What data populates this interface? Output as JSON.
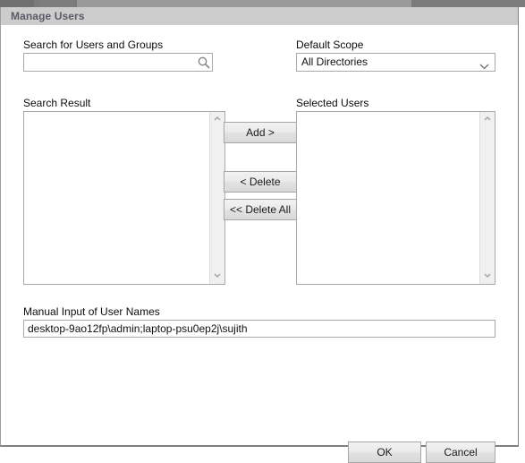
{
  "window": {
    "title": "Manage Users"
  },
  "search": {
    "label": "Search for Users and Groups",
    "value": "",
    "placeholder": "",
    "icon": "search-icon"
  },
  "scope": {
    "label": "Default Scope",
    "selected": "All Directories",
    "options": [
      "All Directories"
    ],
    "icon": "chevron-down-icon"
  },
  "search_result": {
    "label": "Search Result",
    "items": [],
    "scroll_up_icon": "chevron-up-icon",
    "scroll_down_icon": "chevron-down-icon"
  },
  "selected_users": {
    "label": "Selected Users",
    "items": [],
    "scroll_up_icon": "chevron-up-icon",
    "scroll_down_icon": "chevron-down-icon"
  },
  "transfer_buttons": {
    "add": "Add >",
    "delete": "< Delete",
    "delete_all": "<< Delete All"
  },
  "manual_input": {
    "label": "Manual Input of User Names",
    "value": "desktop-9ao12fp\\admin;laptop-psu0ep2j\\sujith",
    "placeholder": ""
  },
  "footer": {
    "ok": "OK",
    "cancel": "Cancel"
  },
  "colors": {
    "titlebar_bg": "#cccccc",
    "titlebar_text": "#5a5a66",
    "dialog_bg": "#ffffff",
    "border": "#a9a9a9",
    "button_face": "#eaeaea",
    "scrollbar_track": "#f0f0f0"
  }
}
